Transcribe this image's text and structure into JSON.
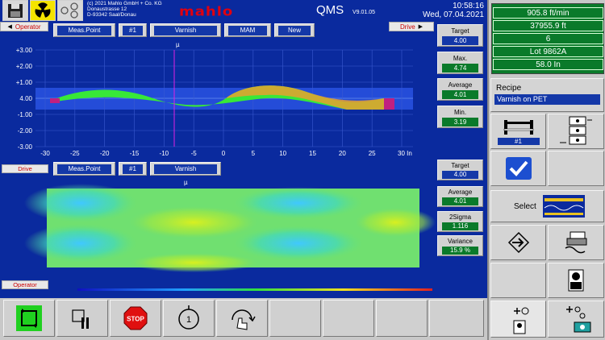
{
  "header": {
    "copyright_line1": "(c) 2021 Mahlo GmbH + Co. KG",
    "copyright_line2": "Donaustrasse 12",
    "copyright_line3": "D-93342 Saal/Donau",
    "logo": "mahlo",
    "app_title": "QMS",
    "version": "V9.01.05",
    "time": "10:58:16",
    "date": "Wed, 07.04.2021"
  },
  "top_chart": {
    "operator_label": "Operator",
    "drive_label": "Drive",
    "selectors": [
      "Meas.Point",
      "#1",
      "Varnish",
      "MAM",
      "New"
    ],
    "unit_label": "µ",
    "y_ticks": [
      "+3.00",
      "+2.00",
      "+1.00",
      "4.00",
      "-1.00",
      "-2.00",
      "-3.00"
    ],
    "x_ticks": [
      "-30",
      "-25",
      "-20",
      "-15",
      "-10",
      "-5",
      "0",
      "5",
      "10",
      "15",
      "20",
      "25",
      "30 In"
    ],
    "stats": [
      {
        "label": "Target",
        "value": "4.00"
      },
      {
        "label": "Max.",
        "value": "4.74"
      },
      {
        "label": "Average",
        "value": "4.01"
      },
      {
        "label": "Min.",
        "value": "3.19"
      }
    ]
  },
  "bottom_chart": {
    "drive_label": "Drive",
    "operator_label": "Operator",
    "selectors": [
      "Meas.Point",
      "#1",
      "Varnish"
    ],
    "unit_label": "µ",
    "stats": [
      {
        "label": "Target",
        "value": "4.00"
      },
      {
        "label": "Average",
        "value": "4.01"
      },
      {
        "label": "2Sigma",
        "value": "1.116"
      },
      {
        "label": "Variance",
        "value": "15.9 %"
      }
    ]
  },
  "right_panel": {
    "speed": "905.8 ft/min",
    "length": "37955.9 ft",
    "count": "6",
    "lot": "Lot 9862A",
    "width": "58.0 In",
    "recipe_label": "Recipe",
    "recipe_value": "Varnish on PET",
    "point_label": "#1",
    "select_label": "Select"
  },
  "toolbar": {
    "stop_label": "STOP",
    "counter_label": "1"
  },
  "colors": {
    "background": "#0a2a9e",
    "panel": "#c8c8c8",
    "green_value": "#0a7a2a",
    "blue_value": "#1438a8",
    "logo_red": "#e00010"
  }
}
